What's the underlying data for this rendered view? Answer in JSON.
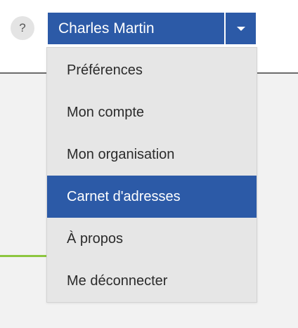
{
  "header": {
    "help_label": "?",
    "user_name": "Charles Martin",
    "caret_icon": "caret-down-icon"
  },
  "dropdown": {
    "items": [
      {
        "label": "Préférences",
        "active": false
      },
      {
        "label": "Mon compte",
        "active": false
      },
      {
        "label": "Mon organisation",
        "active": false
      },
      {
        "label": "Carnet d'adresses",
        "active": true
      },
      {
        "label": "À propos",
        "active": false
      },
      {
        "label": "Me déconnecter",
        "active": false
      }
    ]
  },
  "colors": {
    "accent": "#2c5aa7",
    "menu_background": "#e6e6e6",
    "progress_green": "#8dc63f"
  }
}
